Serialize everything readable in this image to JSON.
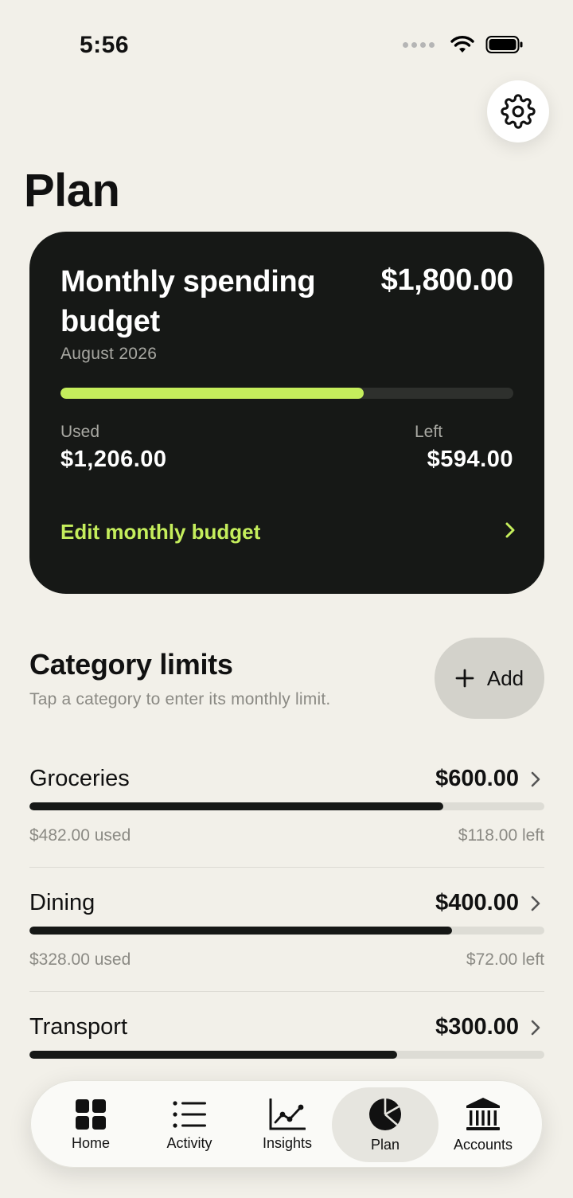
{
  "status_bar": {
    "time": "5:56"
  },
  "page": {
    "title": "Plan"
  },
  "budget_card": {
    "title": "Monthly spending budget",
    "amount": "$1,800.00",
    "month": "August 2026",
    "progress": 0.67,
    "used_label": "Used",
    "used_value": "$1,206.00",
    "left_label": "Left",
    "left_value": "$594.00",
    "edit_label": "Edit monthly budget"
  },
  "category_section": {
    "title": "Category limits",
    "subtitle": "Tap a category to enter its monthly limit.",
    "add_label": "Add"
  },
  "categories": [
    {
      "name": "Groceries",
      "limit": "$600.00",
      "used": "$482.00 used",
      "left": "$118.00 left",
      "progress": 0.803
    },
    {
      "name": "Dining",
      "limit": "$400.00",
      "used": "$328.00 used",
      "left": "$72.00 left",
      "progress": 0.82
    },
    {
      "name": "Transport",
      "limit": "$300.00",
      "progress": 0.714
    }
  ],
  "tab_bar": {
    "items": [
      {
        "label": "Home",
        "icon": "grid-icon"
      },
      {
        "label": "Activity",
        "icon": "list-icon"
      },
      {
        "label": "Insights",
        "icon": "chart-icon"
      },
      {
        "label": "Plan",
        "icon": "pie-icon",
        "active": true
      },
      {
        "label": "Accounts",
        "icon": "bank-icon"
      }
    ]
  },
  "colors": {
    "background": "#f2f0e9",
    "card": "#161816",
    "accent": "#c5ee5c",
    "muted": "#8b8a84"
  }
}
